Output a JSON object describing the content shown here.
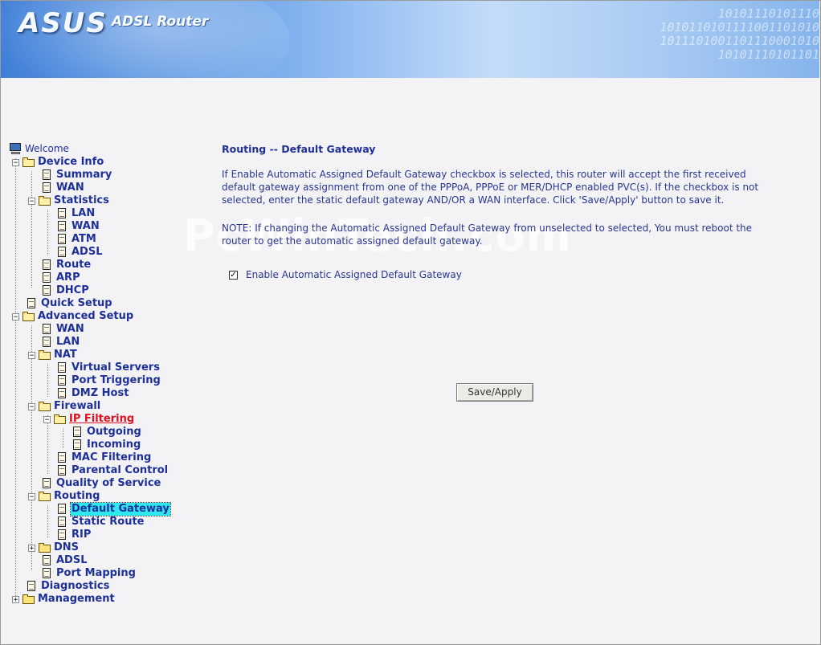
{
  "header": {
    "brand": "ASUS",
    "product": "ADSL Router",
    "binary": "10101110101110\n1010110101111001101010\n1011101001101110001010\n10101110101101"
  },
  "watermark": "PcWinTech.com",
  "tree": {
    "welcome": "Welcome",
    "device_info": "Device Info",
    "summary": "Summary",
    "wan": "WAN",
    "statistics": "Statistics",
    "stat_lan": "LAN",
    "stat_wan": "WAN",
    "stat_atm": "ATM",
    "stat_adsl": "ADSL",
    "route": "Route",
    "arp": "ARP",
    "dhcp": "DHCP",
    "quick_setup": "Quick Setup",
    "advanced_setup": "Advanced Setup",
    "adv_wan": "WAN",
    "adv_lan": "LAN",
    "nat": "NAT",
    "virtual_servers": "Virtual Servers",
    "port_triggering": "Port Triggering",
    "dmz_host": "DMZ Host",
    "firewall": "Firewall",
    "ip_filtering": "IP Filtering",
    "outgoing": "Outgoing",
    "incoming": "Incoming",
    "mac_filtering": "MAC Filtering",
    "parental_control": "Parental Control",
    "qos": "Quality of Service",
    "routing": "Routing",
    "default_gateway": "Default Gateway",
    "static_route": "Static Route",
    "rip": "RIP",
    "dns": "DNS",
    "adsl": "ADSL",
    "port_mapping": "Port Mapping",
    "diagnostics": "Diagnostics",
    "management": "Management"
  },
  "main": {
    "title": "Routing -- Default Gateway",
    "description": "If Enable Automatic Assigned Default Gateway checkbox is selected, this router will accept the first received default gateway assignment from one of the PPPoA, PPPoE or MER/DHCP enabled PVC(s). If the checkbox is not selected, enter the static default gateway AND/OR a WAN interface. Click 'Save/Apply' button to save it.",
    "note": "NOTE: If changing the Automatic Assigned Default Gateway from unselected to selected, You must reboot the router to get the automatic assigned default gateway.",
    "checkbox_label": "Enable Automatic Assigned Default Gateway",
    "checkbox_checked": true,
    "save_button": "Save/Apply"
  }
}
